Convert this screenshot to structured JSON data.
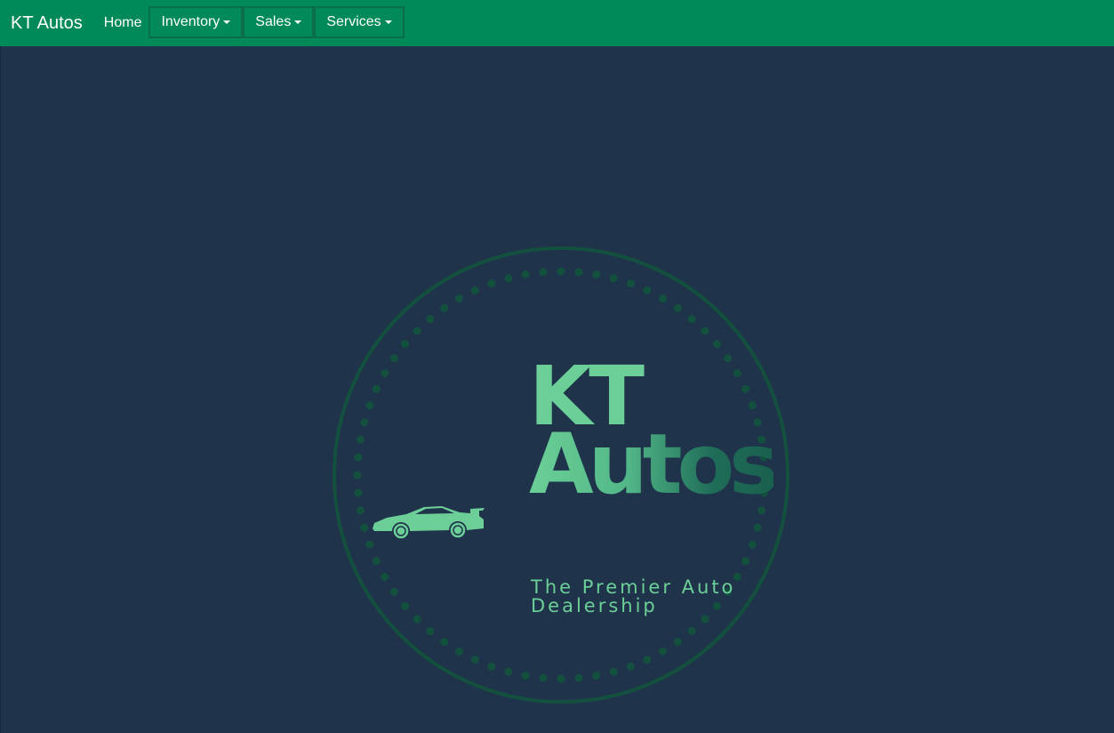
{
  "navbar": {
    "brand": "KT Autos",
    "home_label": "Home",
    "dropdowns": [
      {
        "label": "Inventory"
      },
      {
        "label": "Sales"
      },
      {
        "label": "Services"
      }
    ]
  },
  "logo": {
    "line1": "KT",
    "line2": "Autos",
    "tagline": "The Premier Auto Dealership"
  },
  "colors": {
    "navbar_bg": "#008a57",
    "page_bg": "#1f334b",
    "logo_green": "#6ccf97",
    "logo_dark_green": "#1a604f"
  }
}
